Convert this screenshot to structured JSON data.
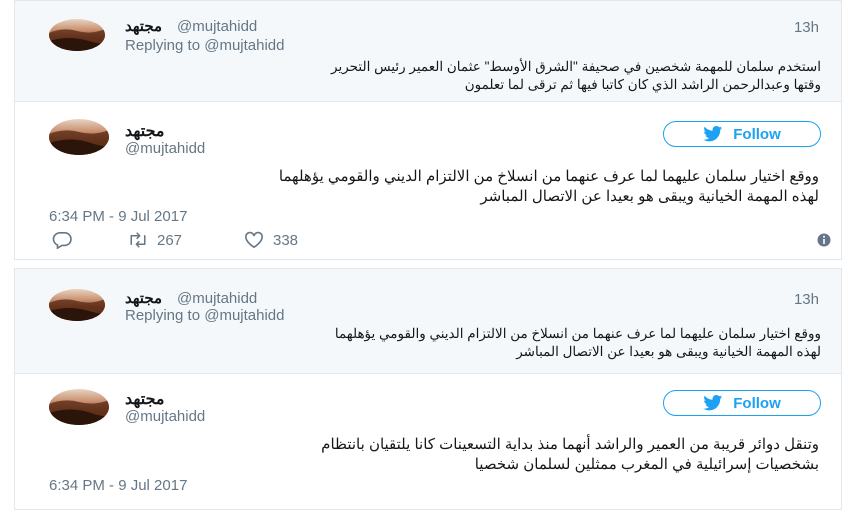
{
  "tweet1": {
    "reply": {
      "name": "مجتهد",
      "handle": "@mujtahidd",
      "time": "13h",
      "replying_prefix": "Replying to",
      "replying_to": "@mujtahidd",
      "lines": [
        "استخدم سلمان للمهمة شخصين في صحيفة \"الشرق الأوسط\" عثمان العمير رئيس التحرير",
        "وقتها وعبدالرحمن الراشد الذي كان كاتبا فيها ثم ترقى لما تعلمون"
      ]
    },
    "main": {
      "name": "مجتهد",
      "handle": "@mujtahidd",
      "follow_label": "Follow",
      "lines": [
        "ووقع اختيار سلمان عليهما لما عرف عنهما من انسلاخ من الالتزام الديني والقومي يؤهلهما",
        "لهذه المهمة الخيانية ويبقى هو بعيدا عن الاتصال المباشر"
      ],
      "date": "6:34 PM - 9 Jul 2017",
      "retweets": "267",
      "likes": "338"
    }
  },
  "tweet2": {
    "reply": {
      "name": "مجتهد",
      "handle": "@mujtahidd",
      "time": "13h",
      "replying_prefix": "Replying to",
      "replying_to": "@mujtahidd",
      "lines": [
        "ووقع اختيار سلمان عليهما لما عرف عنهما من انسلاخ من الالتزام الديني والقومي يؤهلهما",
        "لهذه المهمة الخيانية ويبقى هو بعيدا عن الاتصال المباشر"
      ]
    },
    "main": {
      "name": "مجتهد",
      "handle": "@mujtahidd",
      "follow_label": "Follow",
      "lines": [
        "وتنقل دوائر قريبة من العمير والراشد أنهما منذ بداية التسعينات كانا يلتقيان بانتظام",
        "بشخصيات إسرائيلية في المغرب ممثلين لسلمان شخصيا"
      ],
      "date": "6:34 PM - 9 Jul 2017"
    }
  },
  "colors": {
    "accent": "#1da1f2",
    "muted": "#657786",
    "reply_bg": "#f5f8fa",
    "border": "#e1e8ed"
  },
  "icons": [
    "avatar",
    "twitter-bird-icon",
    "reply-icon",
    "retweet-icon",
    "heart-icon",
    "info-icon"
  ]
}
